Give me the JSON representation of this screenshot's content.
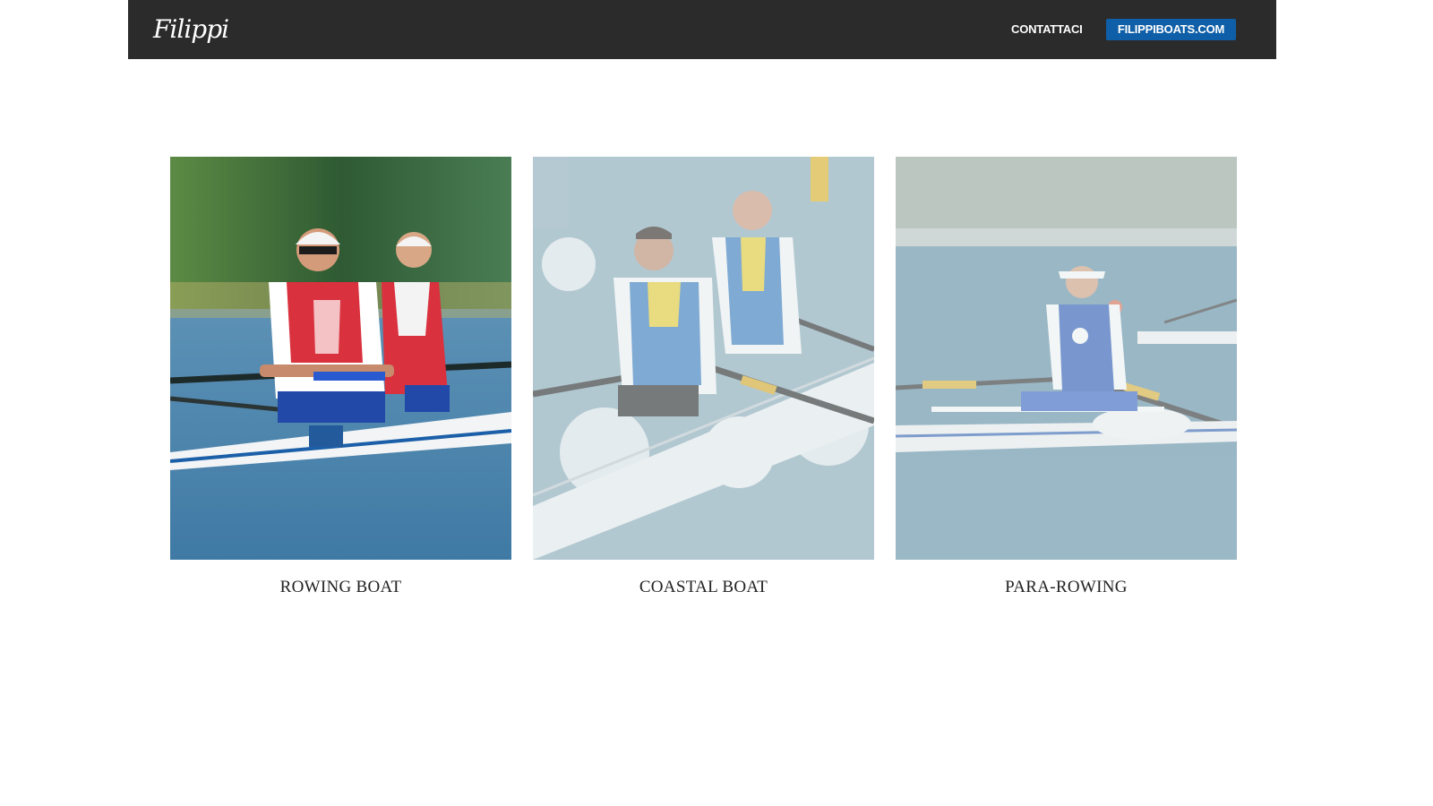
{
  "header": {
    "logo_text": "Filippi",
    "contact_label": "CONTATTACI",
    "site_button_label": "FILIPPIBOATS.COM",
    "background_color": "#2b2b2b",
    "button_color": "#0f5fa8"
  },
  "categories": [
    {
      "label": "ROWING BOAT",
      "image_icon": "rowing-double-photo"
    },
    {
      "label": "COASTAL BOAT",
      "image_icon": "coastal-double-photo"
    },
    {
      "label": "PARA-ROWING",
      "image_icon": "para-rowing-single-photo"
    }
  ]
}
